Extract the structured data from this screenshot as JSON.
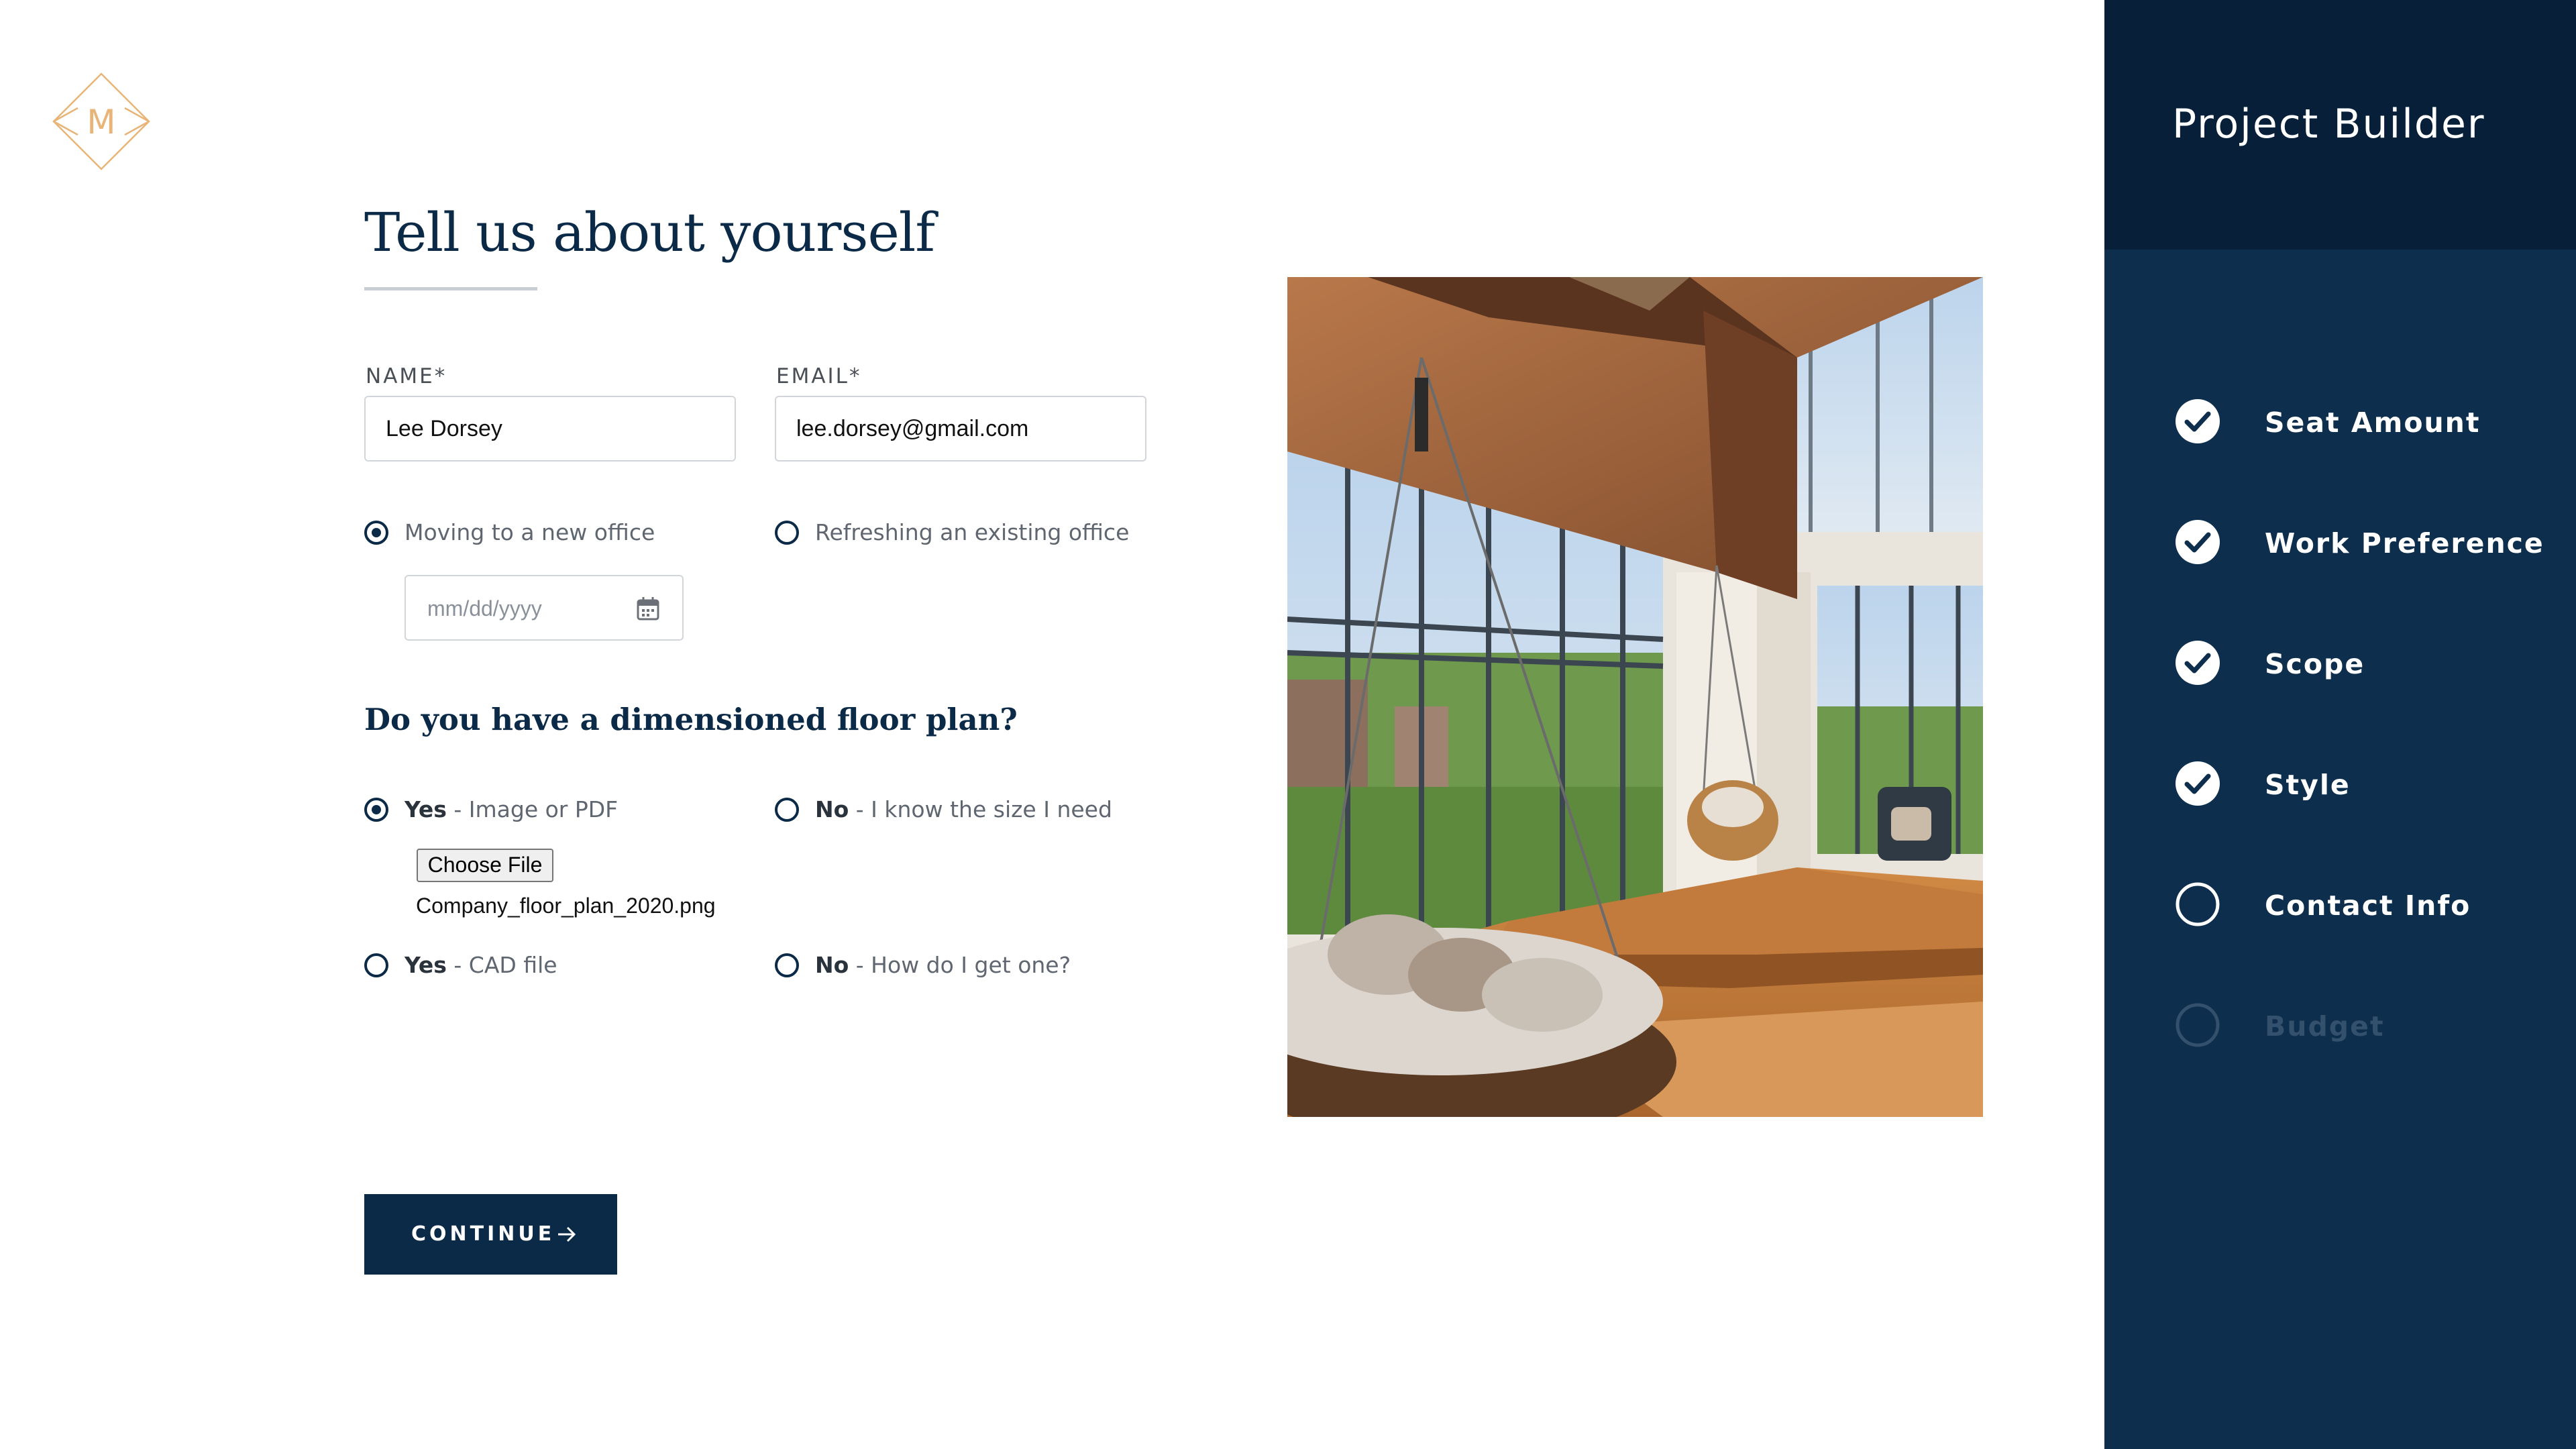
{
  "logo": {
    "letter": "M",
    "color": "#e8b478"
  },
  "form": {
    "title": "Tell us about yourself",
    "name_label": "NAME*",
    "name_value": "Lee Dorsey",
    "email_label": "EMAIL*",
    "email_value": "lee.dorsey@gmail.com",
    "move_options": [
      {
        "label": "Moving to a new office",
        "selected": true
      },
      {
        "label": "Refreshing an existing office",
        "selected": false
      }
    ],
    "date_placeholder": "mm/dd/yyyy",
    "floor_plan_question": "Do you have a dimensioned floor plan?",
    "floor_plan_options": [
      {
        "strong": "Yes",
        "rest": " - Image or PDF",
        "selected": true
      },
      {
        "strong": "No",
        "rest": " - I know the size I need",
        "selected": false
      },
      {
        "strong": "Yes",
        "rest": " - CAD file",
        "selected": false
      },
      {
        "strong": "No",
        "rest": " - How do I get one?",
        "selected": false
      }
    ],
    "choose_file_label": "Choose File",
    "file_name": "Company_floor_plan_2020.png",
    "continue_label": "CONTINUE"
  },
  "sidebar": {
    "title": "Project Builder",
    "steps": [
      {
        "label": "Seat Amount",
        "status": "complete"
      },
      {
        "label": "Work Preference",
        "status": "complete"
      },
      {
        "label": "Scope",
        "status": "complete"
      },
      {
        "label": "Style",
        "status": "complete"
      },
      {
        "label": "Contact Info",
        "status": "current"
      },
      {
        "label": "Budget",
        "status": "upcoming"
      }
    ]
  },
  "colors": {
    "navy": "#0b2a47",
    "sidebar": "#0e2e4d",
    "sidebar_header": "#071f39",
    "accent": "#e8b478"
  }
}
